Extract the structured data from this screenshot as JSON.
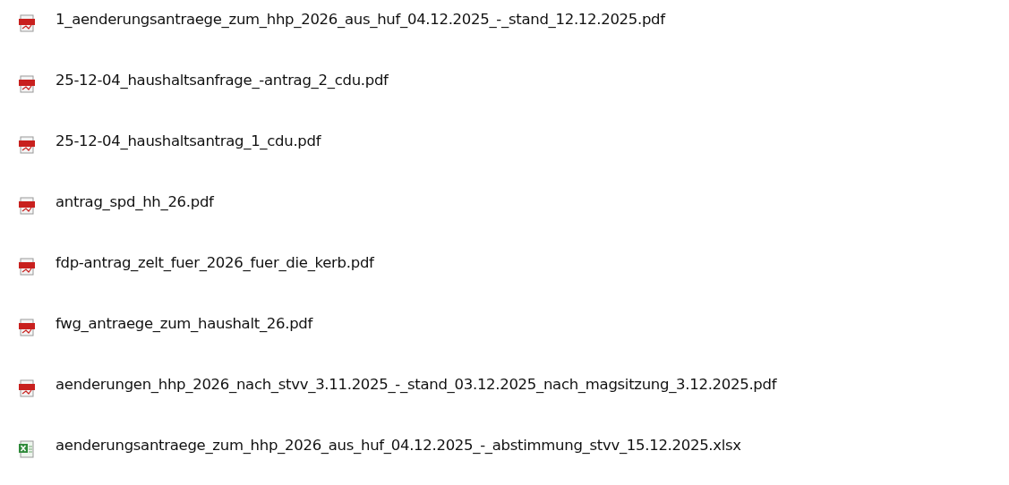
{
  "files": [
    {
      "name": "1_aenderungsantraege_zum_hhp_2026_aus_huf_04.12.2025_-_stand_12.12.2025.pdf",
      "kind": "pdf"
    },
    {
      "name": "25-12-04_haushaltsanfrage_-antrag_2_cdu.pdf",
      "kind": "pdf"
    },
    {
      "name": "25-12-04_haushaltsantrag_1_cdu.pdf",
      "kind": "pdf"
    },
    {
      "name": "antrag_spd_hh_26.pdf",
      "kind": "pdf"
    },
    {
      "name": "fdp-antrag_zelt_fuer_2026_fuer_die_kerb.pdf",
      "kind": "pdf"
    },
    {
      "name": "fwg_antraege_zum_haushalt_26.pdf",
      "kind": "pdf"
    },
    {
      "name": "aenderungen_hhp_2026_nach_stvv_3.11.2025_-_stand_03.12.2025_nach_magsitzung_3.12.2025.pdf",
      "kind": "pdf"
    },
    {
      "name": "aenderungsantraege_zum_hhp_2026_aus_huf_04.12.2025_-_abstimmung_stvv_15.12.2025.xlsx",
      "kind": "xlsx"
    }
  ]
}
